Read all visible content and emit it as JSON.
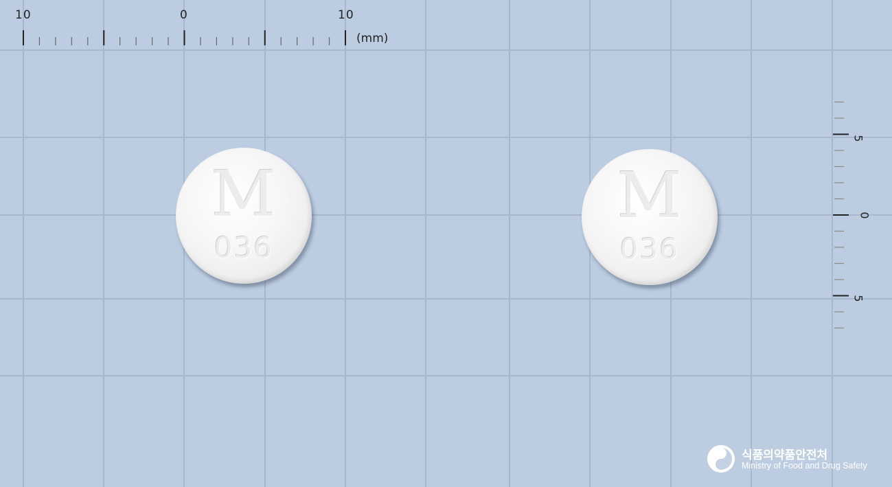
{
  "ruler_top": {
    "labels": [
      "10",
      "0",
      "10"
    ],
    "unit": "(mm)"
  },
  "ruler_right": {
    "labels": [
      "5",
      "0",
      "5"
    ]
  },
  "tablets": [
    {
      "letter": "M",
      "code": "036"
    },
    {
      "letter": "M",
      "code": "036"
    }
  ],
  "logo": {
    "korean": "식품의약품안전처",
    "english": "Ministry of Food and Drug Safety"
  },
  "colors": {
    "background": "#bccde2",
    "grid": "#a8b8cc",
    "tablet": "#f3f3f3",
    "ruler_ink": "#222222"
  }
}
